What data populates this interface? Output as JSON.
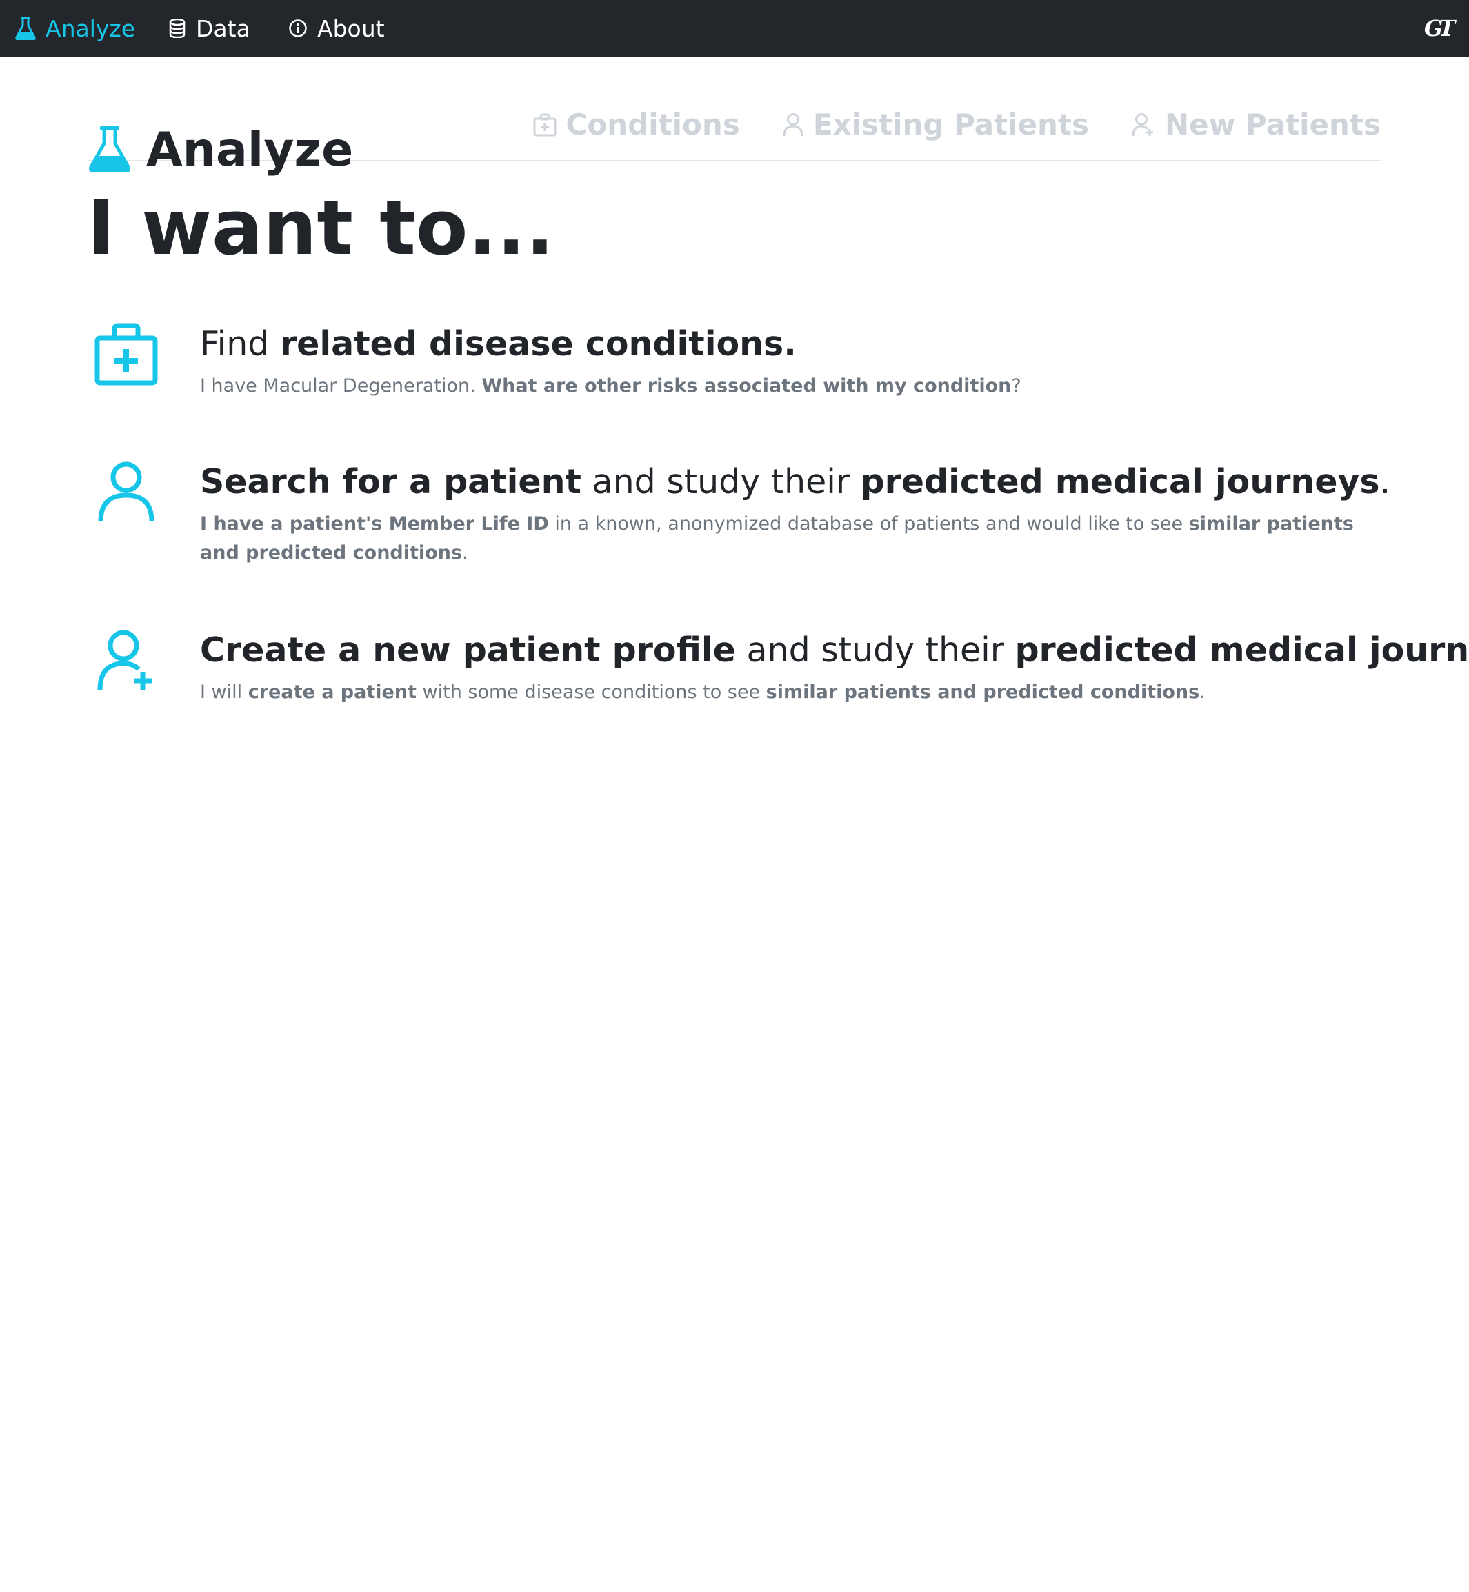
{
  "navbar": {
    "items": [
      {
        "label": "Analyze",
        "icon": "flask-icon",
        "active": true
      },
      {
        "label": "Data",
        "icon": "database-icon",
        "active": false
      },
      {
        "label": "About",
        "icon": "info-circle-icon",
        "active": false
      }
    ],
    "logo": "GT"
  },
  "header": {
    "title": "Analyze",
    "tabs": [
      {
        "label": "Conditions",
        "icon": "medkit-icon"
      },
      {
        "label": "Existing Patients",
        "icon": "user-icon"
      },
      {
        "label": "New Patients",
        "icon": "user-plus-icon"
      }
    ]
  },
  "main": {
    "title": "I want to...",
    "options": [
      {
        "icon": "medkit-icon",
        "heading": [
          {
            "text": "Find ",
            "bold": false
          },
          {
            "text": "related disease conditions.",
            "bold": true
          }
        ],
        "description": [
          {
            "text": "I have Macular Degeneration. ",
            "bold": false
          },
          {
            "text": "What are other risks associated with my condition",
            "bold": true
          },
          {
            "text": "?",
            "bold": false
          }
        ]
      },
      {
        "icon": "user-icon",
        "heading": [
          {
            "text": "Search for a patient",
            "bold": true
          },
          {
            "text": " and study their ",
            "bold": false
          },
          {
            "text": "predicted medical journeys",
            "bold": true
          },
          {
            "text": ".",
            "bold": false
          }
        ],
        "description": [
          {
            "text": "I have a patient's Member Life ID",
            "bold": true
          },
          {
            "text": " in a known, anonymized database of patients and would like to see ",
            "bold": false
          },
          {
            "text": "similar patients and predicted conditions",
            "bold": true
          },
          {
            "text": ".",
            "bold": false
          }
        ]
      },
      {
        "icon": "user-plus-icon",
        "heading": [
          {
            "text": "Create a new patient profile",
            "bold": true
          },
          {
            "text": " and study their ",
            "bold": false
          },
          {
            "text": "predicted medical journey",
            "bold": true
          },
          {
            "text": ".",
            "bold": false
          }
        ],
        "description": [
          {
            "text": "I will ",
            "bold": false
          },
          {
            "text": "create a patient",
            "bold": true
          },
          {
            "text": " with some disease conditions to see ",
            "bold": false
          },
          {
            "text": "similar patients and predicted conditions",
            "bold": true
          },
          {
            "text": ".",
            "bold": false
          }
        ]
      }
    ]
  },
  "colors": {
    "accent": "#17c5e8",
    "navbar_bg": "#23262b",
    "tab_inactive": "#ced4da",
    "text_muted": "#6c757d"
  }
}
